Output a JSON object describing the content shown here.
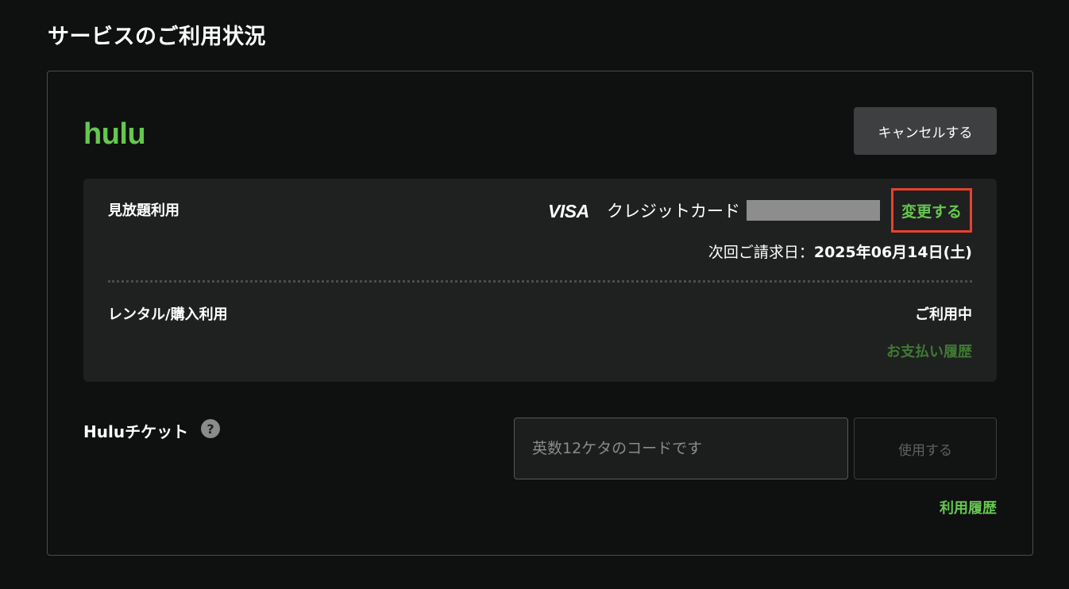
{
  "page": {
    "title": "サービスのご利用状況"
  },
  "service": {
    "logo_text": "hulu",
    "cancel_label": "キャンセルする"
  },
  "subscription": {
    "label": "見放題利用",
    "card_brand": "VISA",
    "payment_method": "クレジットカード",
    "change_label": "変更する",
    "next_billing_prefix": "次回ご請求日：",
    "next_billing_date": "2025年06月14日(土)"
  },
  "rental": {
    "label": "レンタル/購入利用",
    "status": "ご利用中",
    "payment_history_label": "お支払い履歴"
  },
  "ticket": {
    "label": "Huluチケット",
    "help_symbol": "?",
    "input_placeholder": "英数12ケタのコードです",
    "input_value": "",
    "use_label": "使用する",
    "usage_history_label": "利用履歴"
  },
  "colors": {
    "brand_green": "#66c750",
    "highlight_red": "#e8412c",
    "background": "#0f1010",
    "panel": "#1f2020"
  }
}
